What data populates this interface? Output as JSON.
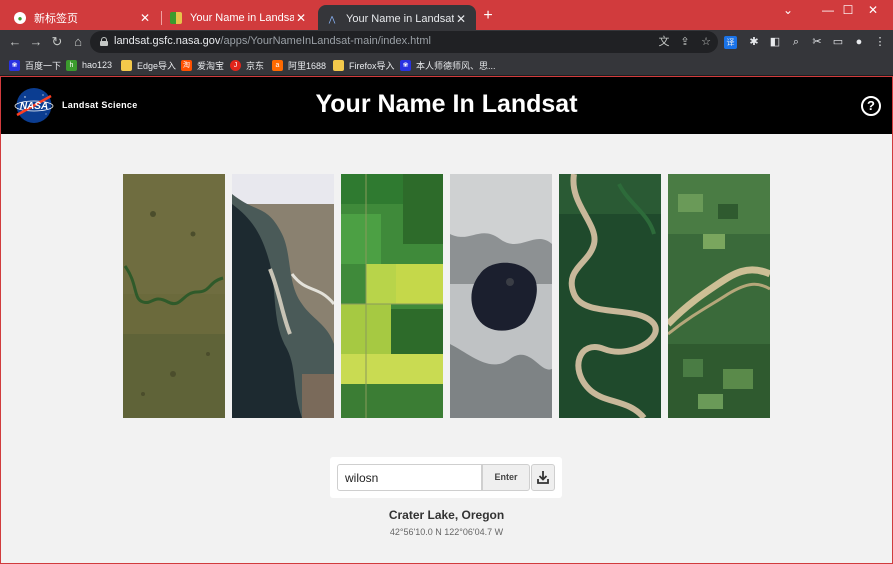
{
  "browser": {
    "tabs": [
      {
        "title": "新标签页",
        "active": false
      },
      {
        "title": "Your Name in Landsat",
        "active": false
      },
      {
        "title": "Your Name in Landsat",
        "active": true
      }
    ],
    "url": {
      "host": "landsat.gsfc.nasa.gov",
      "path": "/apps/YourNameInLandsat-main/index.html"
    },
    "bookmarks": [
      {
        "label": "百度一下",
        "icon": "baidu-icon",
        "color": "#2932e1"
      },
      {
        "label": "hao123",
        "icon": "hao123-icon",
        "color": "#3b9b2d"
      },
      {
        "label": "Edge导入",
        "icon": "folder-icon",
        "color": "#f3c94b"
      },
      {
        "label": "爱淘宝",
        "icon": "taobao-icon",
        "color": "#ff5000"
      },
      {
        "label": "京东",
        "icon": "jd-icon",
        "color": "#e1251b"
      },
      {
        "label": "阿里1688",
        "icon": "alibaba-icon",
        "color": "#ff6a00"
      },
      {
        "label": "Firefox导入",
        "icon": "folder-icon",
        "color": "#f3c94b"
      },
      {
        "label": "本人师德师风、思...",
        "icon": "baidu-icon",
        "color": "#2932e1"
      }
    ]
  },
  "site": {
    "brand": "Landsat Science",
    "title": "Your Name In Landsat",
    "input_value": "wilosn",
    "enter_label": "Enter",
    "location_name": "Crater Lake, Oregon",
    "coordinates": "42°56'10.0 N 122°06'04.7 W",
    "letters": [
      "W",
      "I",
      "L",
      "O",
      "S",
      "N"
    ]
  },
  "colors": {
    "frame": "#d13b3d",
    "header": "#000000",
    "page_bg": "#f2f2f2"
  }
}
